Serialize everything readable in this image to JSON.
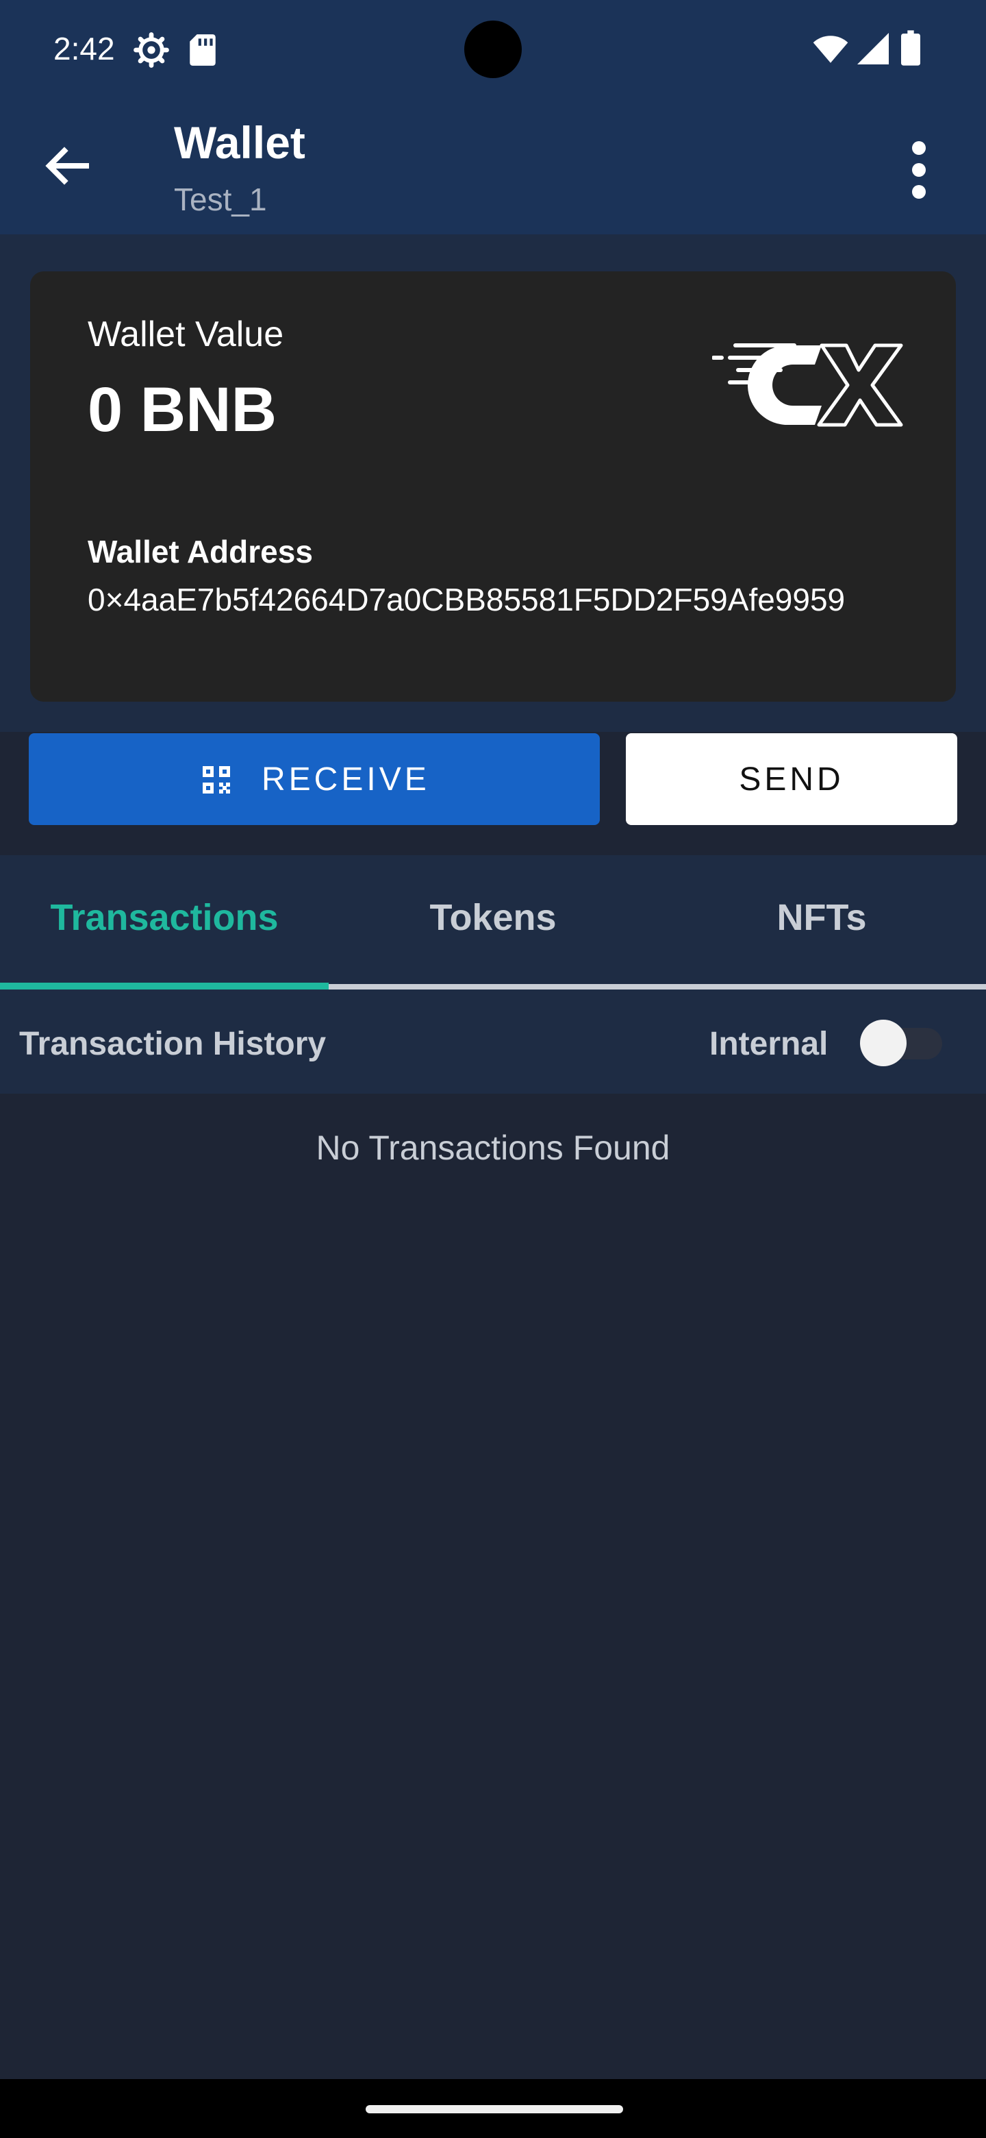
{
  "status_bar": {
    "time": "2:42",
    "left_icons": [
      "settings-gear-icon",
      "sd-card-icon"
    ],
    "right_icons": [
      "wifi-icon",
      "cellular-signal-icon",
      "battery-icon"
    ]
  },
  "app_bar": {
    "title": "Wallet",
    "subtitle": "Test_1",
    "back_icon": "arrow-back-icon",
    "menu_icon": "more-vert-icon"
  },
  "wallet_card": {
    "value_label": "Wallet Value",
    "value_amount": "0 BNB",
    "address_label": "Wallet Address",
    "address": "0×4aaE7b5f42664D7a0CBB85581F5DD2F59Afe9959",
    "logo_icon": "cx-brand-logo"
  },
  "actions": {
    "receive_label": "RECEIVE",
    "receive_icon": "qr-code-icon",
    "send_label": "SEND"
  },
  "tabs": [
    {
      "label": "Transactions",
      "selected": true
    },
    {
      "label": "Tokens",
      "selected": false
    },
    {
      "label": "NFTs",
      "selected": false
    }
  ],
  "history": {
    "title": "Transaction History",
    "toggle_label": "Internal",
    "toggle_on": false,
    "empty_message": "No Transactions Found"
  },
  "colors": {
    "header_bg": "#1b3358",
    "page_bg": "#1e2535",
    "accent": "#1fb89e",
    "primary_button": "#1763c6"
  }
}
